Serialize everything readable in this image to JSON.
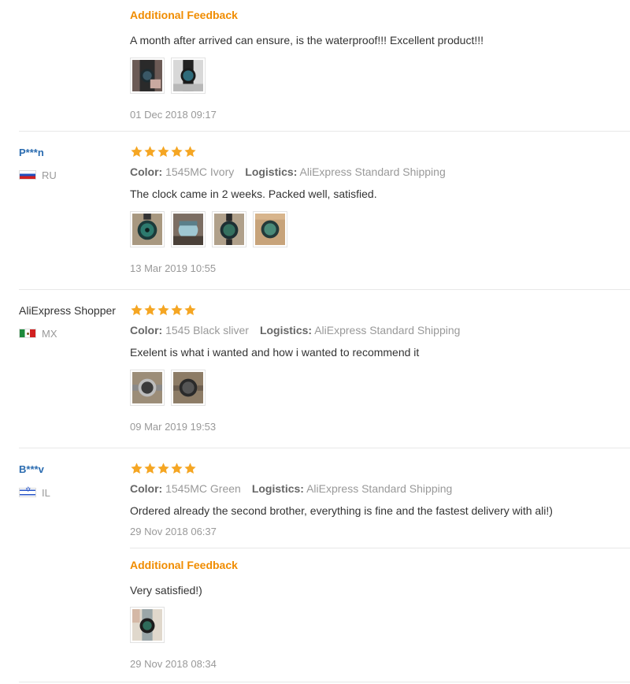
{
  "reviews": [
    {
      "followup": {
        "title": "Additional Feedback",
        "text": "A month after arrived can ensure, is the waterproof!!! Excellent product!!!",
        "date": "01 Dec 2018 09:17"
      }
    },
    {
      "name": "P***n",
      "country": "RU",
      "stars": 5,
      "color_label": "Color:",
      "color": "1545MC Ivory",
      "logistics_label": "Logistics:",
      "logistics": "AliExpress Standard Shipping",
      "text": "The clock came in 2 weeks. Packed well, satisfied.",
      "date": "13 Mar 2019 10:55"
    },
    {
      "name": "AliExpress Shopper",
      "country": "MX",
      "stars": 5,
      "color_label": "Color:",
      "color": "1545 Black sliver",
      "logistics_label": "Logistics:",
      "logistics": "AliExpress Standard Shipping",
      "text": "Exelent is what i wanted and how i wanted to recommend it",
      "date": "09 Mar 2019 19:53"
    },
    {
      "name": "B***v",
      "country": "IL",
      "stars": 5,
      "color_label": "Color:",
      "color": "1545MC Green",
      "logistics_label": "Logistics:",
      "logistics": "AliExpress Standard Shipping",
      "text": "Ordered already the second brother, everything is fine and the fastest delivery with ali!)",
      "date": "29 Nov 2018 06:37",
      "followup": {
        "title": "Additional Feedback",
        "text": "Very satisfied!)",
        "date": "29 Nov 2018 08:34"
      }
    }
  ],
  "colors": {
    "accent": "#f08c00",
    "star": "#f5a623",
    "username": "#2b6cb0",
    "muted": "#999999"
  }
}
